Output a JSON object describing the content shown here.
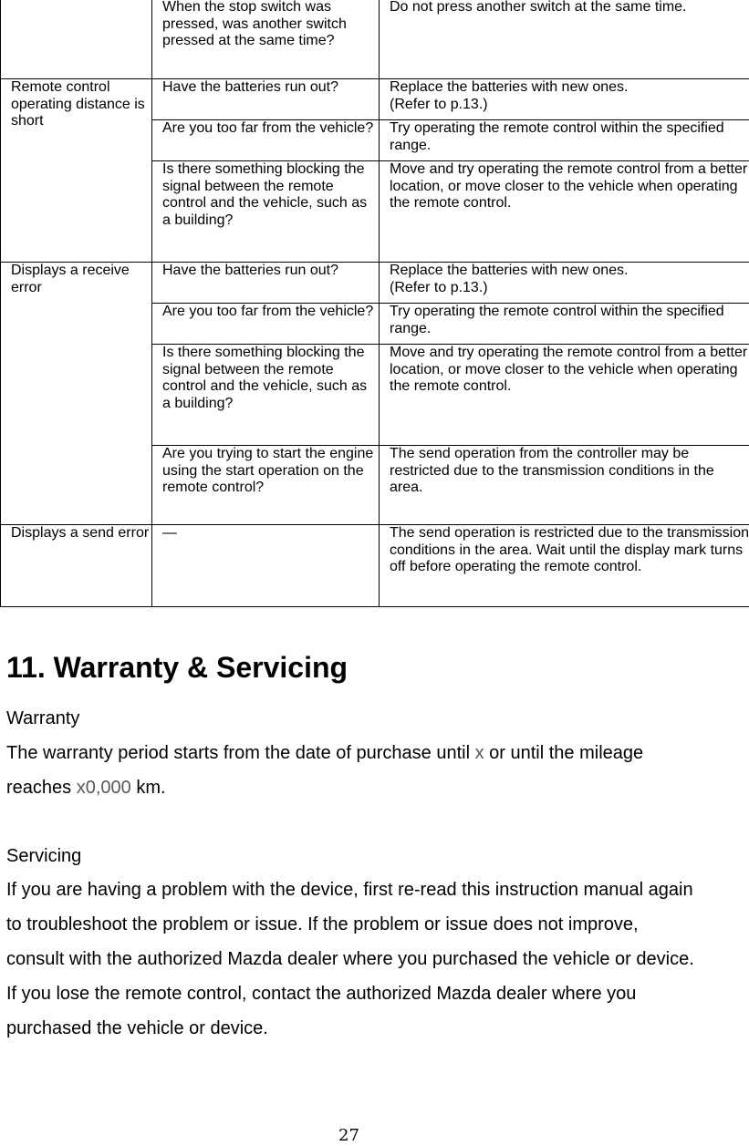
{
  "troubleshooting_table": {
    "rows": [
      {
        "symptom": "",
        "checks": [
          {
            "cause": "When the stop switch was pressed, was another switch pressed at the same time?",
            "remedy": "Do not press another switch at the same time."
          }
        ]
      },
      {
        "symptom": "Remote control operating distance is short",
        "checks": [
          {
            "cause": "Have the batteries run out?",
            "remedy": "Replace the batteries with new ones.\n(Refer to p.13.)"
          },
          {
            "cause": "Are you too far from the vehicle?",
            "remedy": "Try operating the remote control within the specified range."
          },
          {
            "cause": "Is there something blocking the signal between the remote control and the vehicle, such as a building?",
            "remedy": "Move and try operating the remote control from a better location, or move closer to the vehicle when operating the remote control."
          }
        ]
      },
      {
        "symptom": "Displays a receive error",
        "checks": [
          {
            "cause": "Have the batteries run out?",
            "remedy": "Replace the batteries with new ones.\n(Refer to p.13.)"
          },
          {
            "cause": "Are you too far from the vehicle?",
            "remedy": "Try operating the remote control within the specified range."
          },
          {
            "cause": "Is there something blocking the signal between the remote control and the vehicle, such as a building?",
            "remedy": "Move and try operating the remote control from a better location, or move closer to the vehicle when operating the remote control."
          },
          {
            "cause": "Are you trying to start the engine using the start operation on the remote control?",
            "remedy": "The send operation from the controller may be restricted due to the transmission conditions in the area."
          }
        ]
      },
      {
        "symptom": "Displays a send error",
        "checks": [
          {
            "cause": "—",
            "remedy": "The send operation is restricted due to the transmission conditions in the area. Wait until the display mark turns off before operating the remote control."
          }
        ]
      }
    ]
  },
  "section": {
    "title": "11. Warranty & Servicing",
    "warranty": {
      "heading": "Warranty",
      "text_before": "The warranty period starts from the date of purchase until ",
      "period_placeholder": "x",
      "text_middle": " or until the mileage",
      "text_line2_before": "reaches ",
      "mileage_placeholder": "x0,000",
      "text_after": " km."
    },
    "servicing": {
      "heading": "Servicing",
      "lines": [
        "If you are having a problem with the device, first re-read this instruction manual again",
        "to troubleshoot the problem or issue. If the problem or issue does not improve,",
        "consult with the authorized Mazda dealer where you purchased the vehicle or device.",
        "If you lose the remote control, contact the authorized Mazda dealer where you",
        "purchased the vehicle or device."
      ]
    }
  },
  "page_number": "27",
  "colors": {
    "text": "#000000",
    "placeholder_text": "#595959",
    "border": "#000000"
  }
}
